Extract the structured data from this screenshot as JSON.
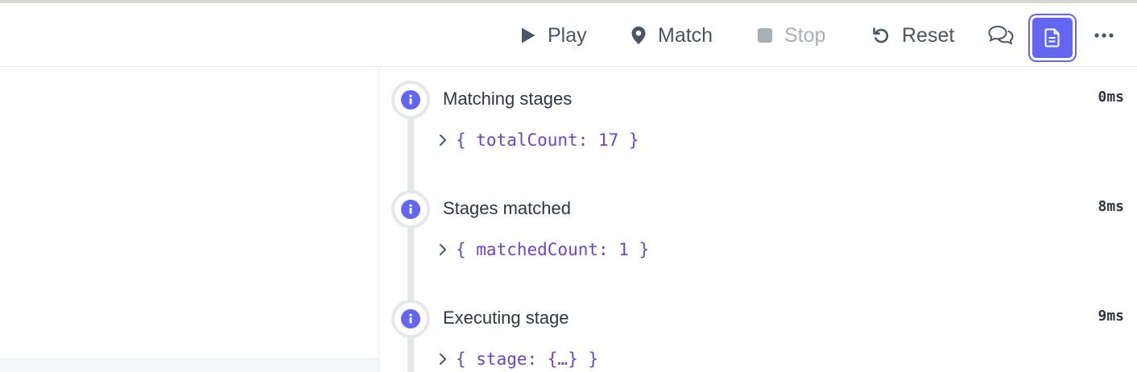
{
  "toolbar": {
    "play_label": "Play",
    "match_label": "Match",
    "stop_label": "Stop",
    "reset_label": "Reset",
    "icons": {
      "play": "play-icon",
      "match": "map-pin-icon",
      "stop": "stop-icon",
      "reset": "reset-icon",
      "chat": "chat-bubbles-icon",
      "log": "document-icon",
      "more": "more-horizontal-icon"
    }
  },
  "events": [
    {
      "title": "Matching stages",
      "time": "0ms",
      "payload": "{ totalCount: 17 }"
    },
    {
      "title": "Stages matched",
      "time": "8ms",
      "payload": "{ matchedCount: 1 }"
    },
    {
      "title": "Executing stage",
      "time": "9ms",
      "payload": "{ stage: {…} }"
    }
  ],
  "colors": {
    "accent": "#6366f1",
    "payload_text": "#6d45c9",
    "toolbar_text": "#4b5563",
    "disabled_text": "#a8aeb6"
  }
}
